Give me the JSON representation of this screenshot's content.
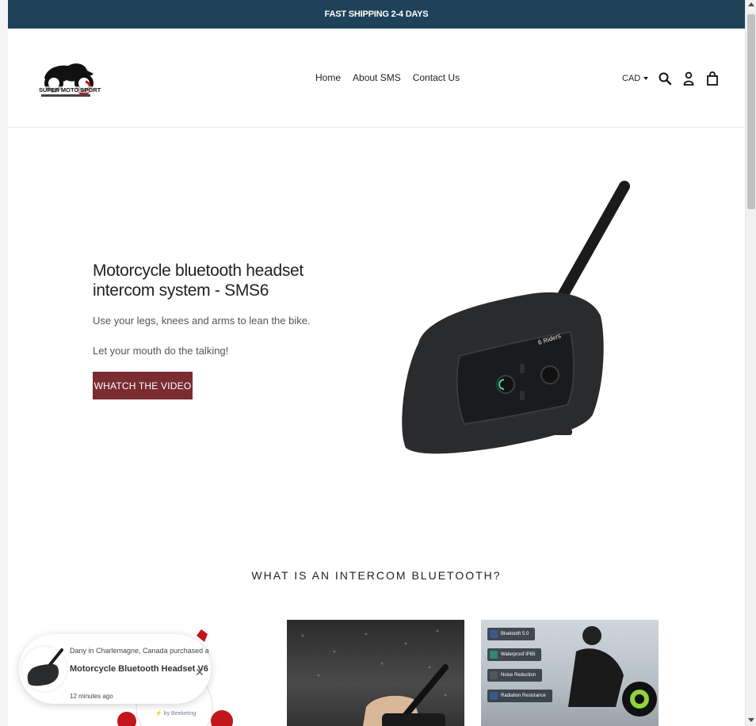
{
  "announcement": {
    "text": "FAST SHIPPING 2-4 DAYS"
  },
  "header": {
    "logo_text": "SUPER MOTO SPORT",
    "nav": [
      "Home",
      "About SMS",
      "Contact Us"
    ],
    "currency": "CAD",
    "icons": [
      "search-icon",
      "account-icon",
      "cart-icon"
    ]
  },
  "hero": {
    "title": "Motorcycle bluetooth headset intercom system - SMS6",
    "line1": "Use your legs, knees and arms to lean the bike.",
    "line2": "Let your mouth do the talking!",
    "button": "WHATCH THE VIDEO",
    "device_brand": "6 Riders"
  },
  "section": {
    "title": "WHAT IS AN INTERCOM BLUETOOTH?"
  },
  "features": [
    "Bluetooth 5.0",
    "Waterproof IP65",
    "Noise Reduction",
    "Radiation Resistance"
  ],
  "popup": {
    "line1": "Dany in Charlemagne, Canada purchased a",
    "product": "Motorcycle Bluetooth Headset V6",
    "time": "12 minutes ago",
    "by": "by Beeketing"
  },
  "colors": {
    "announce_bg": "#1e4258",
    "button_bg": "#7b2c30"
  }
}
